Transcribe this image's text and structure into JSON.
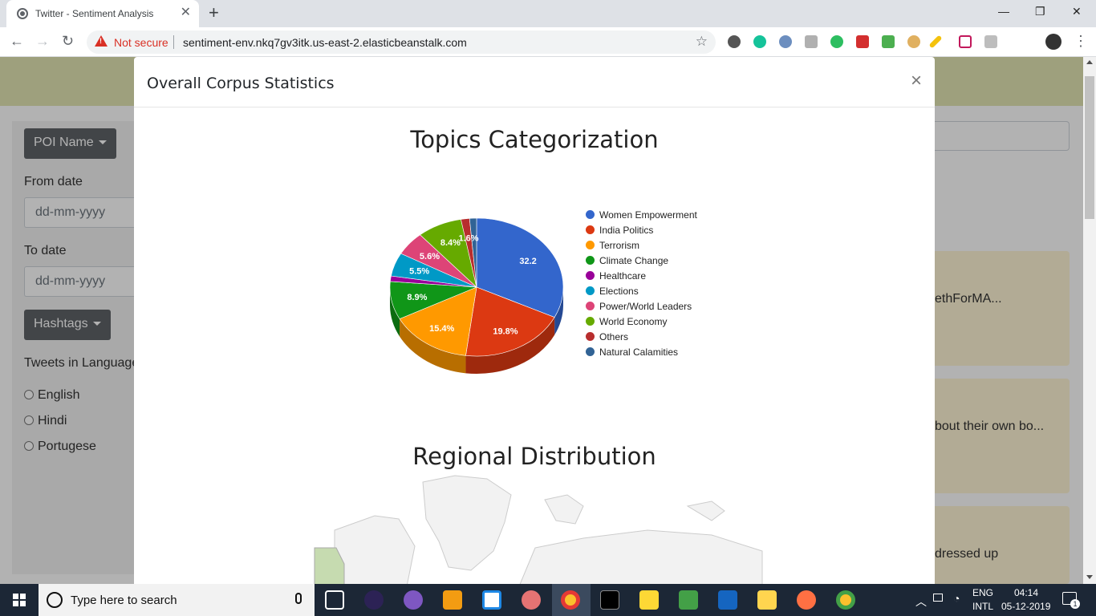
{
  "browser": {
    "tab_title": "Twitter - Sentiment Analysis",
    "tab_close": "✕",
    "new_tab": "+",
    "security_label": "Not secure",
    "url": "sentiment-env.nkq7gv3itk.us-east-2.elasticbeanstalk.com",
    "window_minimize": "—",
    "window_restore": "❐",
    "window_close": "✕"
  },
  "sidebar": {
    "poi_button": "POI Name",
    "from_label": "From date",
    "from_placeholder": "dd-mm-yyyy",
    "to_label": "To date",
    "to_placeholder": "dd-mm-yyyy",
    "hashtags_button": "Hashtags",
    "language_label": "Tweets in Language",
    "languages": [
      "English",
      "Hindi",
      "Portugese"
    ]
  },
  "background_cards": [
    "ethForMA...",
    "bout their own bo...",
    "dressed up"
  ],
  "modal": {
    "title": "Overall Corpus Statistics",
    "close": "×",
    "pie_title": "Topics Categorization",
    "map_title": "Regional Distribution"
  },
  "chart_data": {
    "type": "pie",
    "style": "3d",
    "title": "Topics Categorization",
    "legend_position": "right",
    "series": [
      {
        "name": "Women Empowerment",
        "value": 32.2,
        "label": "32.2",
        "color": "#3366cc"
      },
      {
        "name": "India Politics",
        "value": 19.8,
        "label": "19.8%",
        "color": "#dc3912"
      },
      {
        "name": "Terrorism",
        "value": 15.4,
        "label": "15.4%",
        "color": "#ff9900"
      },
      {
        "name": "Climate Change",
        "value": 8.9,
        "label": "8.9%",
        "color": "#109618"
      },
      {
        "name": "Healthcare",
        "value": 1.3,
        "label": "",
        "color": "#990099"
      },
      {
        "name": "Elections",
        "value": 5.5,
        "label": "5.5%",
        "color": "#0099c6"
      },
      {
        "name": "Power/World Leaders",
        "value": 5.6,
        "label": "5.6%",
        "color": "#dd4477"
      },
      {
        "name": "World Economy",
        "value": 8.4,
        "label": "8.4%",
        "color": "#66aa00"
      },
      {
        "name": "Others",
        "value": 1.6,
        "label": "1.6%",
        "color": "#b82e2e"
      },
      {
        "name": "Natural Calamities",
        "value": 1.3,
        "label": "",
        "color": "#316395"
      }
    ]
  },
  "taskbar": {
    "search_placeholder": "Type here to search",
    "lang_top": "ENG",
    "lang_bottom": "INTL",
    "time": "04:14",
    "date": "05-12-2019",
    "notifications": "1"
  }
}
